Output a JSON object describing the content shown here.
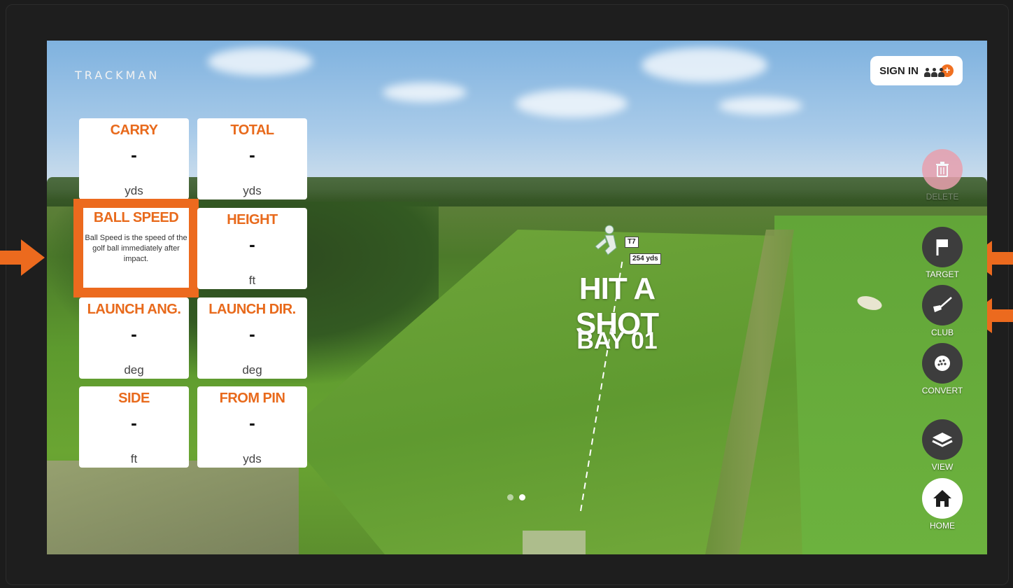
{
  "brand": "TRACKMAN",
  "signin": {
    "label": "SIGN IN",
    "plus": "+"
  },
  "tiles": [
    {
      "label": "CARRY",
      "value": "-",
      "unit": "yds"
    },
    {
      "label": "TOTAL",
      "value": "-",
      "unit": "yds"
    },
    {
      "label": "BALL SPEED",
      "description": "Ball Speed is the speed of the golf ball immediately after impact."
    },
    {
      "label": "HEIGHT",
      "value": "-",
      "unit": "ft"
    },
    {
      "label": "LAUNCH ANG.",
      "value": "-",
      "unit": "deg"
    },
    {
      "label": "LAUNCH DIR.",
      "value": "-",
      "unit": "deg"
    },
    {
      "label": "SIDE",
      "value": "-",
      "unit": "ft"
    },
    {
      "label": "FROM PIN",
      "value": "-",
      "unit": "yds"
    }
  ],
  "center": {
    "title": "HIT A SHOT",
    "bay": "BAY 01"
  },
  "target_marker": {
    "label": "T7",
    "distance": "254 yds"
  },
  "pager": {
    "total": 2,
    "active": 2
  },
  "controls": {
    "delete": "DELETE",
    "target": "TARGET",
    "club": "CLUB",
    "convert": "CONVERT",
    "view": "VIEW",
    "home": "HOME"
  },
  "colors": {
    "accent": "#EC6A1E",
    "tile_bg": "#FFFFFF",
    "button_dark": "#3D3D3D"
  },
  "icons": [
    "trash-icon",
    "flag-icon",
    "golf-club-icon",
    "golf-ball-icon",
    "layers-icon",
    "home-icon",
    "people-add-icon",
    "golfer-icon"
  ]
}
